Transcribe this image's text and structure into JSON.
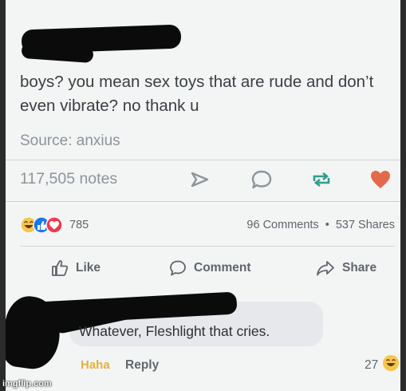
{
  "post": {
    "text": "boys? you mean sex toys that are rude and don’t even vibrate? no thank u",
    "source": "Source: anxius",
    "notes": "117,505 notes"
  },
  "toolbar_icons": [
    "share-arrow-icon",
    "reply-bubble-icon",
    "reblog-icon",
    "heart-icon"
  ],
  "stats": {
    "reaction_count": "785",
    "comments": "96 Comments",
    "separator": "•",
    "shares": "537 Shares"
  },
  "actions": {
    "like": "Like",
    "comment": "Comment",
    "share": "Share"
  },
  "comment": {
    "text": "Whatever, Fleshlight that cries.",
    "haha_label": "Haha",
    "reply_label": "Reply",
    "reaction_count": "27"
  },
  "watermark": "imgflip.com",
  "colors": {
    "background": "#f3f4f4",
    "heart": "#e26a4a",
    "haha_yellow": "#f7c548",
    "like_blue": "#1877f2",
    "love_red": "#f0384f",
    "haha_link": "#e2b33c"
  }
}
